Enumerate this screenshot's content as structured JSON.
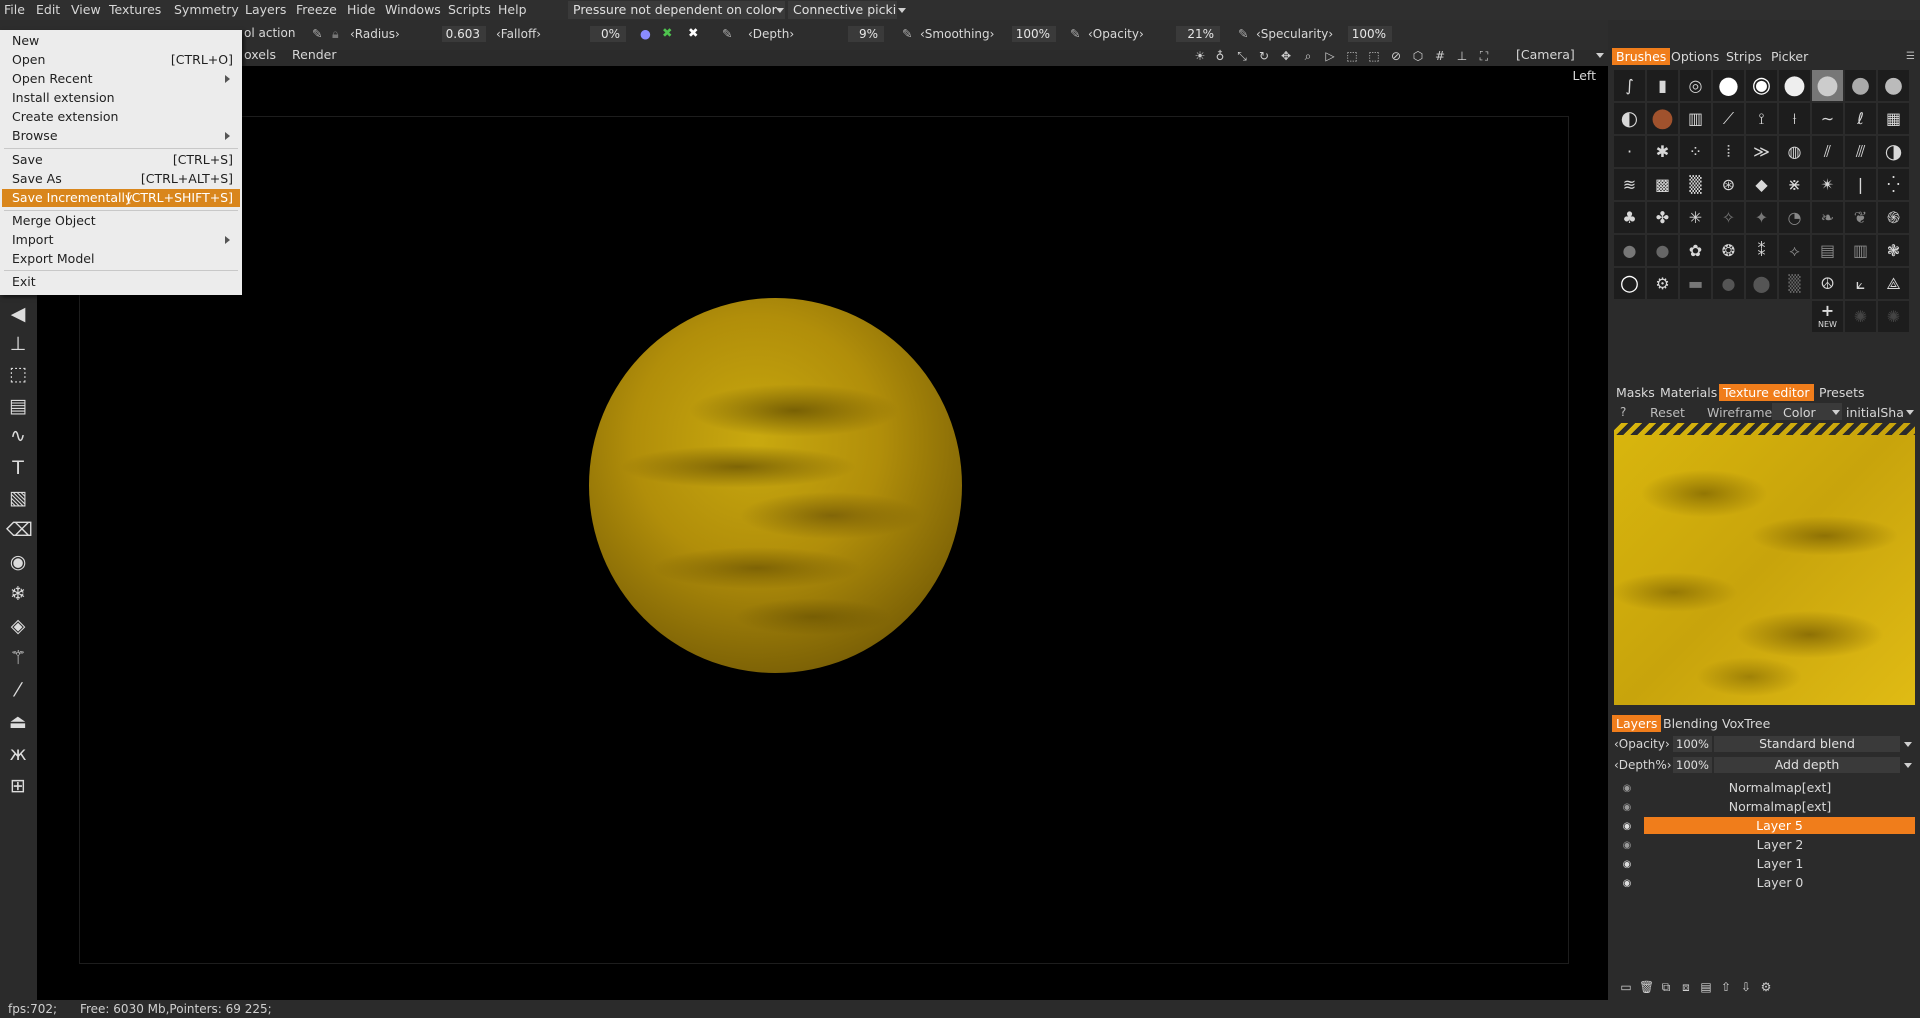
{
  "menubar": {
    "items": [
      "File",
      "Edit",
      "View",
      "Textures",
      "Symmetry",
      "Layers",
      "Freeze",
      "Hide",
      "Windows",
      "Scripts",
      "Help"
    ]
  },
  "toolbar": {
    "hidden_action_text": "ol action",
    "radius_label": "‹Radius›",
    "radius_value": "0.603",
    "falloff_label": "‹Falloff›",
    "falloff_value": "0%",
    "depth_label": "‹Depth›",
    "depth_value": "9%",
    "smoothing_label": "‹Smoothing›",
    "smoothing_value": "100%",
    "opacity_label": "‹Opacity›",
    "opacity_value": "21%",
    "specularity_label": "‹Specularity›",
    "specularity_value": "100%",
    "pressure_dropdown": "Pressure not dependent on color",
    "picking_dropdown": "Connective picki",
    "camera_dropdown": "[Camera]"
  },
  "toolbar2": {
    "voxels_text": "oxels",
    "render_text": "Render"
  },
  "file_menu": {
    "items": [
      {
        "label": "New",
        "shortcut": ""
      },
      {
        "label": "Open",
        "shortcut": "[CTRL+O]"
      },
      {
        "label": "Open Recent",
        "shortcut": ""
      },
      {
        "label": "Install extension",
        "shortcut": ""
      },
      {
        "label": "Create extension",
        "shortcut": ""
      },
      {
        "label": "Browse",
        "shortcut": ""
      },
      {
        "label": "Save",
        "shortcut": "[CTRL+S]"
      },
      {
        "label": "Save As",
        "shortcut": "[CTRL+ALT+S]"
      },
      {
        "label": "Save Incrementally",
        "shortcut": "[CTRL+SHIFT+S]"
      },
      {
        "label": "Merge Object",
        "shortcut": ""
      },
      {
        "label": "Import",
        "shortcut": ""
      },
      {
        "label": "Export Model",
        "shortcut": ""
      },
      {
        "label": "Exit",
        "shortcut": ""
      }
    ],
    "highlighted": "Save Incrementally"
  },
  "viewport": {
    "view_label": "Left"
  },
  "right_panel": {
    "top_tabs": [
      "Brushes",
      "Options",
      "Strips",
      "Picker"
    ],
    "active_top_tab": "Brushes",
    "new_brush_label": "NEW",
    "mid_tabs": [
      "Masks",
      "Materials",
      "Texture editor",
      "Presets"
    ],
    "active_mid_tab": "Texture editor",
    "texture_toolbar": {
      "help": "?",
      "reset": "Reset",
      "wireframe": "Wireframe",
      "color": "Color",
      "shader": "initialSha"
    },
    "layer_tabs": [
      "Layers",
      "Blending",
      "VoxTree"
    ],
    "active_layer_tab": "Layers",
    "opacity_label": "‹Opacity›",
    "opacity_value": "100%",
    "blend_mode": "Standard blend",
    "depth_label": "‹Depth%›",
    "depth_value": "100%",
    "depth_mode": "Add depth",
    "layers": [
      {
        "name": "Normalmap[ext]",
        "visible": false,
        "active": false
      },
      {
        "name": "Normalmap[ext]",
        "visible": false,
        "active": false
      },
      {
        "name": "Layer 5",
        "visible": true,
        "active": true
      },
      {
        "name": "Layer 2",
        "visible": false,
        "active": false
      },
      {
        "name": "Layer 1",
        "visible": true,
        "active": false
      },
      {
        "name": "Layer 0",
        "visible": true,
        "active": false
      }
    ]
  },
  "status": {
    "text": "fps:702;      Free: 6030 Mb,Pointers: 69 225;"
  },
  "colors": {
    "accent": "#f07d1b",
    "menu_highlight": "#d9861c",
    "planet": "#b18e0a"
  }
}
